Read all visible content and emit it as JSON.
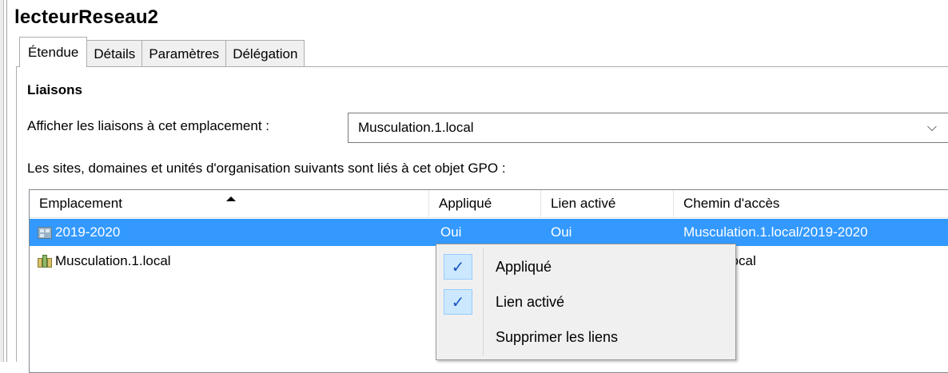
{
  "window": {
    "title": "lecteurReseau2"
  },
  "tabs": [
    {
      "label": "Étendue"
    },
    {
      "label": "Détails"
    },
    {
      "label": "Paramètres"
    },
    {
      "label": "Délégation"
    }
  ],
  "scope": {
    "section_title": "Liaisons",
    "display_links_label": "Afficher les liaisons à cet emplacement :",
    "location_value": "Musculation.1.local",
    "linked_label": "Les sites, domaines et unités d'organisation suivants sont liés à cet objet GPO :"
  },
  "table": {
    "columns": [
      "Emplacement",
      "Appliqué",
      "Lien activé",
      "Chemin d'accès"
    ],
    "rows": [
      {
        "location": "2019-2020",
        "applied": "Oui",
        "enabled": "Oui",
        "path": "Musculation.1.local/2019-2020",
        "icon": "ou-icon"
      },
      {
        "location": "Musculation.1.local",
        "applied": "",
        "enabled": "",
        "path": "ation.1.local",
        "icon": "domain-icon"
      }
    ]
  },
  "context_menu": {
    "items": [
      {
        "label": "Appliqué",
        "checked": true
      },
      {
        "label": "Lien activé",
        "checked": true
      },
      {
        "label": "Supprimer les liens",
        "checked": false
      }
    ]
  },
  "colors": {
    "selection": "#3399ff",
    "check_bg": "#cce8ff"
  }
}
